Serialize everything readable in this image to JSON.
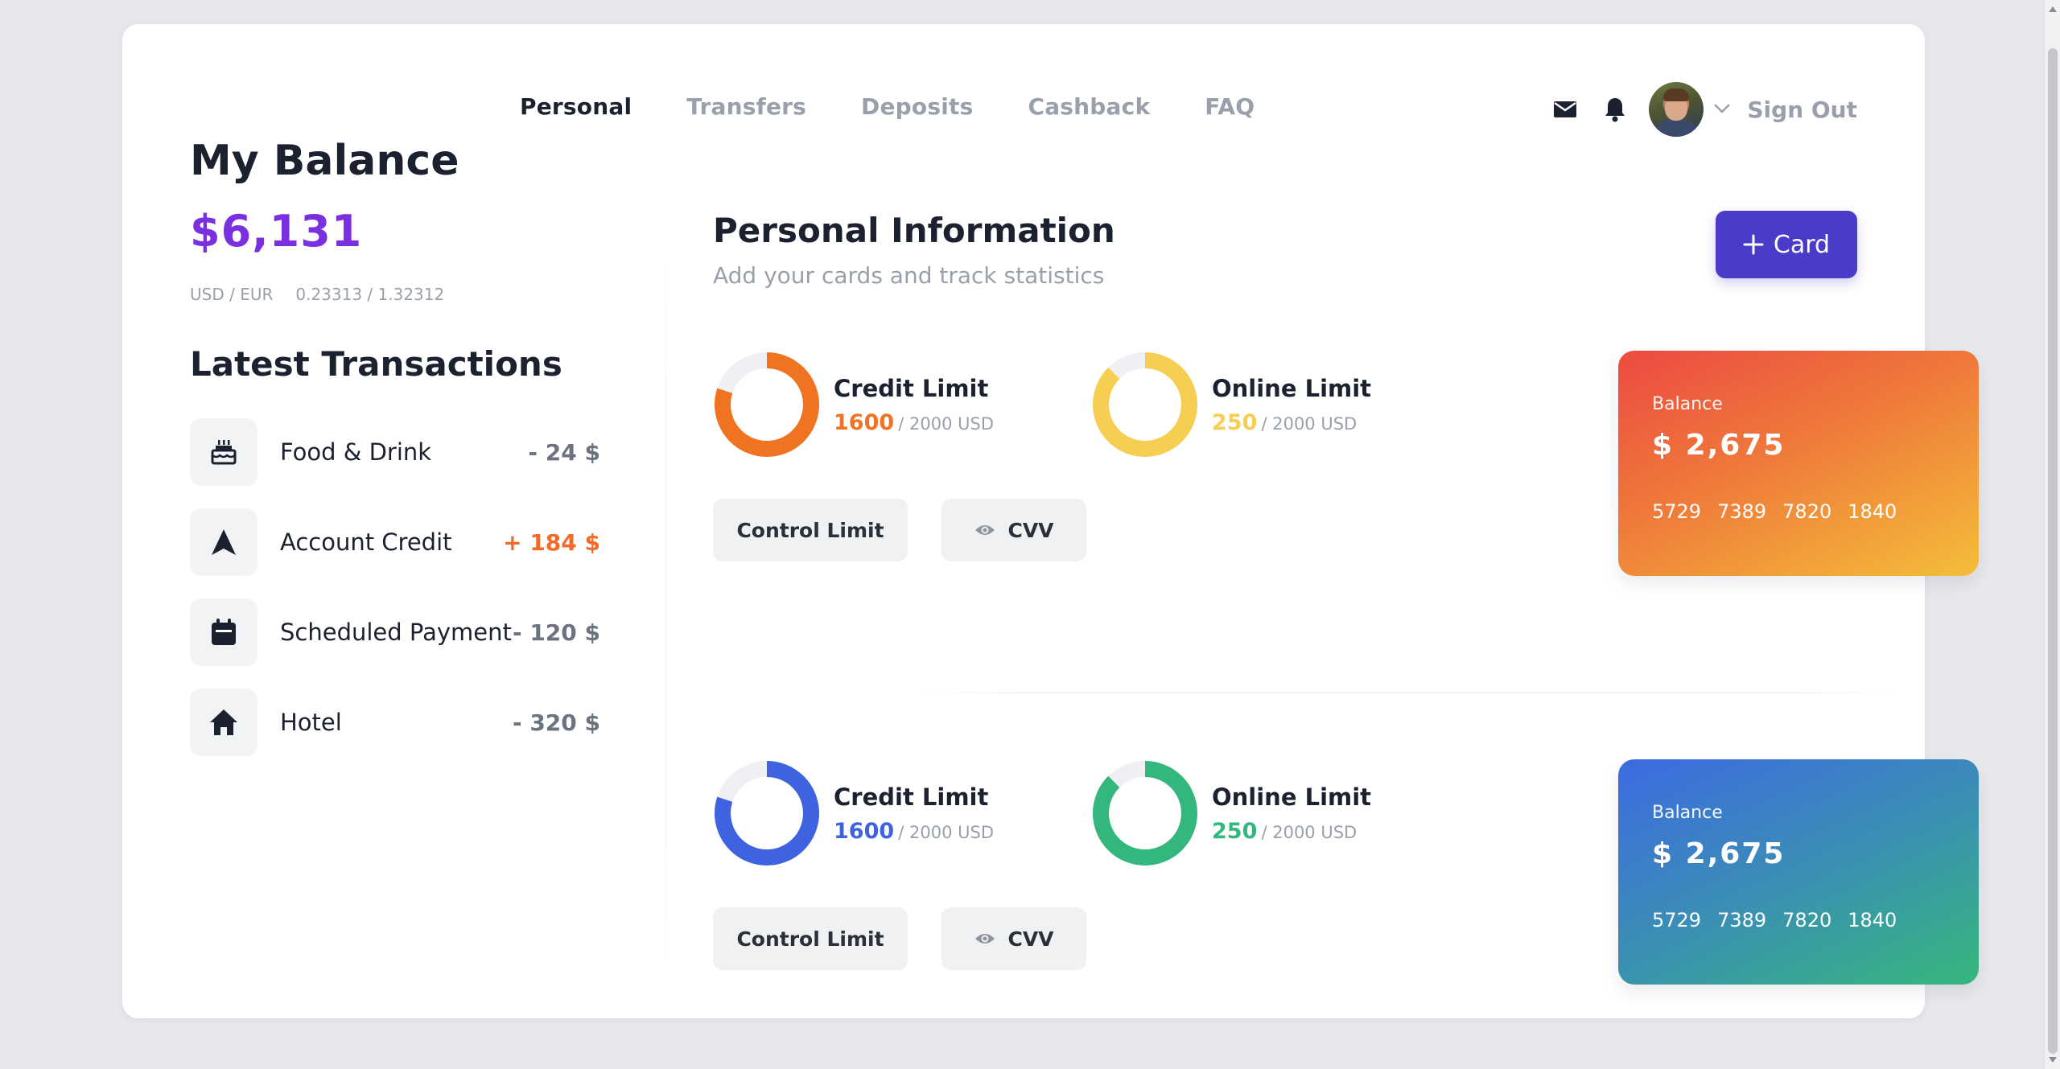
{
  "nav": {
    "items": [
      {
        "label": "Personal",
        "active": true
      },
      {
        "label": "Transfers",
        "active": false
      },
      {
        "label": "Deposits",
        "active": false
      },
      {
        "label": "Cashback",
        "active": false
      },
      {
        "label": "FAQ",
        "active": false
      }
    ],
    "sign_out": "Sign Out"
  },
  "balance": {
    "title": "My Balance",
    "value": "$6,131",
    "currency_pair": "USD / EUR",
    "rate": "0.23313 / 1.32312"
  },
  "transactions": {
    "title": "Latest Transactions",
    "items": [
      {
        "icon": "cake-icon",
        "label": "Food & Drink",
        "amount": "- 24 $",
        "positive": false
      },
      {
        "icon": "navigation-arrow-icon",
        "label": "Account Credit",
        "amount": "+ 184 $",
        "positive": true
      },
      {
        "icon": "calendar-icon",
        "label": "Scheduled Payment",
        "amount": "- 120 $",
        "positive": false
      },
      {
        "icon": "home-icon",
        "label": "Hotel",
        "amount": "- 320 $",
        "positive": false
      }
    ]
  },
  "personal_info": {
    "title": "Personal Information",
    "subtitle": "Add your cards and track statistics",
    "add_card_label": "Card"
  },
  "cards": [
    {
      "credit_limit": {
        "title": "Credit Limit",
        "value": "1600",
        "total": "/ 2000 USD",
        "fraction": 0.8,
        "color": "#f07322"
      },
      "online_limit": {
        "title": "Online Limit",
        "value": "250",
        "total": "/ 2000 USD",
        "fraction": 0.875,
        "color": "#f6cf52"
      },
      "control_label": "Control Limit",
      "cvv_label": "CVV",
      "card": {
        "label": "Balance",
        "balance": "$ 2,675",
        "number": [
          "5729",
          "7389",
          "7820",
          "1840"
        ],
        "theme": "orange"
      }
    },
    {
      "credit_limit": {
        "title": "Credit Limit",
        "value": "1600",
        "total": "/ 2000 USD",
        "fraction": 0.8,
        "color": "#3f63e0"
      },
      "online_limit": {
        "title": "Online Limit",
        "value": "250",
        "total": "/ 2000 USD",
        "fraction": 0.875,
        "color": "#34b77c"
      },
      "control_label": "Control Limit",
      "cvv_label": "CVV",
      "card": {
        "label": "Balance",
        "balance": "$ 2,675",
        "number": [
          "5729",
          "7389",
          "7820",
          "1840"
        ],
        "theme": "blue"
      }
    }
  ],
  "colors": {
    "accent": "#4a3cc9",
    "balance": "#7a2fe0",
    "positive": "#f06a2a",
    "track": "#eef0f3"
  }
}
